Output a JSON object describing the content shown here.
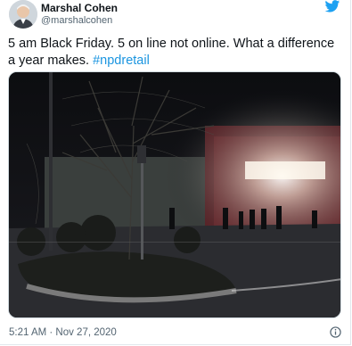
{
  "author": {
    "name": "Marshal Cohen",
    "handle": "@marshalcohen",
    "avatar_icon": "profile-photo"
  },
  "tweet": {
    "text": "5 am Black Friday. 5 on line not online. What a difference a year makes.",
    "hashtag": "#npdretail"
  },
  "media": {
    "icon": "photo-storefront-night"
  },
  "footer": {
    "timestamp": "5:21 AM · Nov 27, 2020",
    "info_icon": "info-icon"
  },
  "colors": {
    "brand": "#1da1f2",
    "hashtag": "#1b95e0",
    "secondary_text": "#536471"
  }
}
